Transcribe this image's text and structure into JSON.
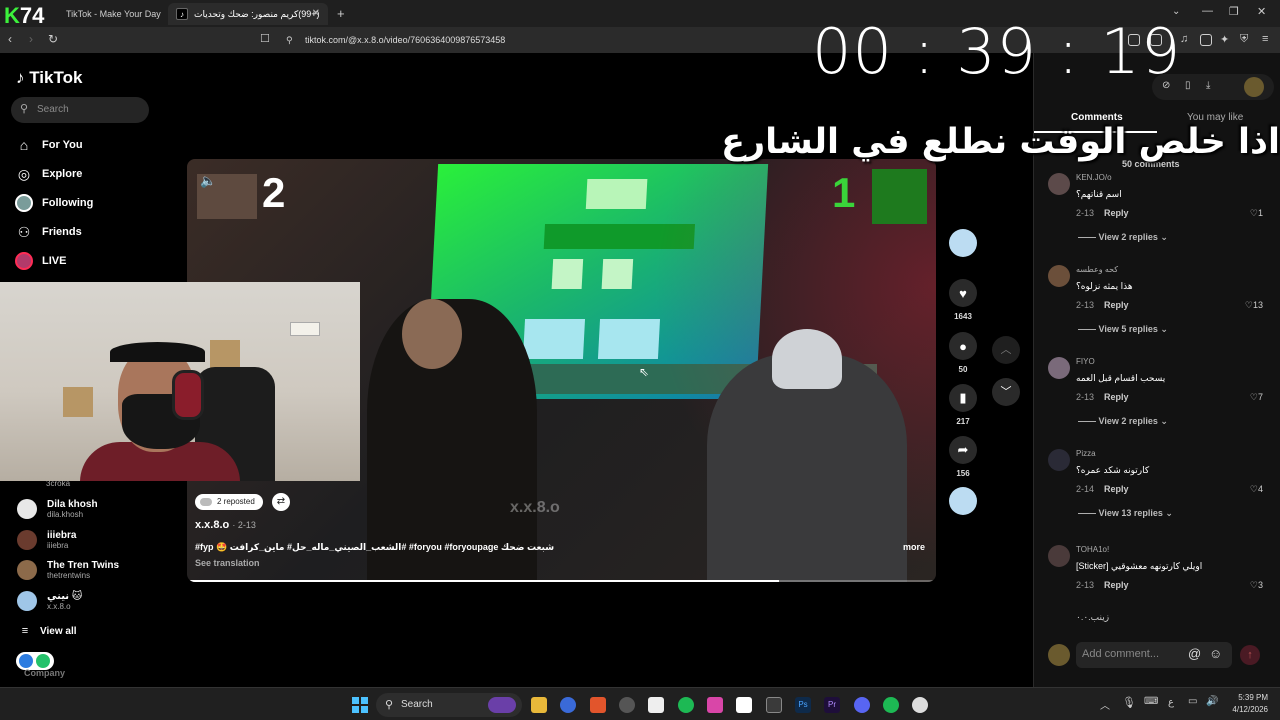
{
  "browser": {
    "tabs": [
      {
        "title": "TikTok - Make Your Day",
        "active": false
      },
      {
        "title": "(+99)كريم منصور: ضحك وتحديات",
        "active": true
      }
    ],
    "new_tab": "+",
    "url": "tiktok.com/@x.x.8.o/video/7606364009876573458"
  },
  "overlay": {
    "stream_tag_k": "K",
    "stream_tag_num": "74",
    "timer": "00 : 39 : 19",
    "arabic_text": "اذا خلص الوقت نطلع في الشارع"
  },
  "sidebar": {
    "logo": "TikTok",
    "search_placeholder": "Search",
    "nav": [
      {
        "label": "For You",
        "icon": "home-icon"
      },
      {
        "label": "Explore",
        "icon": "compass-icon"
      },
      {
        "label": "Following",
        "icon": "following-icon"
      },
      {
        "label": "Friends",
        "icon": "friends-icon"
      },
      {
        "label": "LIVE",
        "icon": "live-icon"
      }
    ],
    "following_partial": "3croka",
    "following": [
      {
        "name": "Dila khosh",
        "handle": "dila.khosh"
      },
      {
        "name": "iiiebra",
        "handle": "iiiebra"
      },
      {
        "name": "The Tren Twins",
        "handle": "thetrentwins"
      },
      {
        "name": "نيني 🐱",
        "handle": "x.x.8.o"
      }
    ],
    "view_all": "View all",
    "company": "Company"
  },
  "video": {
    "overlay_left_num": "2",
    "overlay_right_num": "1",
    "reposted": "2 reposted",
    "author": "x.x.8.o",
    "date": "2-13",
    "caption": "#fyp 🤩 الشعب_الصيني_ماله_حل# ماين_كرافت# #foryou #foryoupage شبعت ضحك",
    "see_translation": "See translation",
    "more": "more",
    "watermark": "x.x.8.o",
    "progress": 0.79
  },
  "actions": {
    "likes": "1643",
    "comments": "50",
    "saves": "217",
    "shares": "156"
  },
  "panel": {
    "tab_comments": "Comments",
    "tab_you_may_like": "You may like",
    "count": "50 comments",
    "comments": [
      {
        "user": "KEN.JO/o",
        "text": "اسم قناتهم؟",
        "date": "2-13",
        "likes": "1",
        "replies": "View 2 replies"
      },
      {
        "user": "كحه وعطسه",
        "text": "هذا يمثه نزلوه؟",
        "date": "2-13",
        "likes": "13",
        "replies": "View 5 replies"
      },
      {
        "user": "FIYO",
        "text": "يسحب اقسام قبل العمه",
        "date": "2-13",
        "likes": "7",
        "replies": "View 2 replies"
      },
      {
        "user": "Pizza",
        "text": "كارتونه شكد عمره؟",
        "date": "2-14",
        "likes": "4",
        "replies": "View 13 replies"
      },
      {
        "user": "TOHA1o!",
        "text": "[Sticker] اويلي كارتونهه معشوقيي",
        "date": "2-13",
        "likes": "3",
        "replies": ""
      }
    ],
    "last_partial": "زينب.٠.٠",
    "reply_label": "Reply",
    "add_comment_placeholder": "Add comment..."
  },
  "taskbar": {
    "search": "Search",
    "time": "5:39 PM",
    "date": "4/12/2026"
  },
  "colors": {
    "accent": "#fe2c55",
    "panel_bg": "#121212",
    "progress": "#ffffff"
  }
}
